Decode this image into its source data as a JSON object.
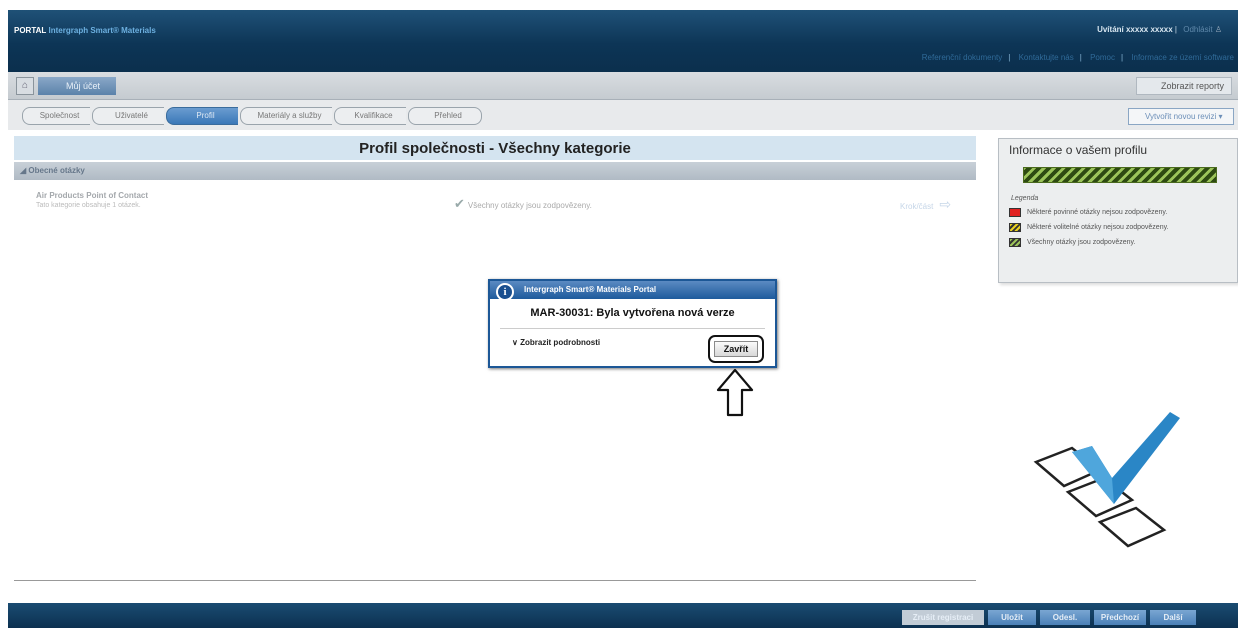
{
  "header": {
    "portal": "PORTAL",
    "brand": "Intergraph Smart® Materials",
    "welcome": "Uvítání xxxxx xxxxx",
    "separator": "|",
    "logout": "Odhlásit",
    "links": [
      "Referenční dokumenty",
      "Kontaktujte nás",
      "Pomoc",
      "Informace ze území software"
    ]
  },
  "toolbar": {
    "account_tab": "Můj účet",
    "reports_button": "Zobrazit reporty"
  },
  "steps": [
    "Společnost",
    "Uživatelé",
    "Profil",
    "Materiály a služby",
    "Kvalifikace",
    "Přehled"
  ],
  "active_step": "Profil",
  "new_revision": "Vytvořit novou revizi",
  "main": {
    "title": "Profil společnosti - Všechny kategorie",
    "section": "Obecné otázky",
    "question": {
      "title": "Air Products Point of Contact",
      "subtitle": "Tato kategorie obsahuje 1 otázek.",
      "status": "Všechny otázky jsou zodpovězeny.",
      "step_link": "Krok/část"
    }
  },
  "sidebar": {
    "title": "Informace o vašem profilu",
    "legend_title": "Legenda",
    "legend": [
      {
        "label": "Některé povinné otázky nejsou zodpovězeny.",
        "color": "#e02020"
      },
      {
        "label": "Některé volitelné otázky nejsou zodpovězeny.",
        "color": "#e8d020"
      },
      {
        "label": "Všechny otázky jsou zodpovězeny.",
        "color": "#7ab030"
      }
    ]
  },
  "footer": {
    "buttons": [
      "Zrušit registraci",
      "Uložit",
      "Odesl.",
      "Předchozí",
      "Další"
    ]
  },
  "dialog": {
    "title": "Intergraph Smart® Materials Portal",
    "message": "MAR-30031: Byla vytvořena nová verze",
    "details": "Zobrazit podrobnosti",
    "close": "Zavřít"
  }
}
